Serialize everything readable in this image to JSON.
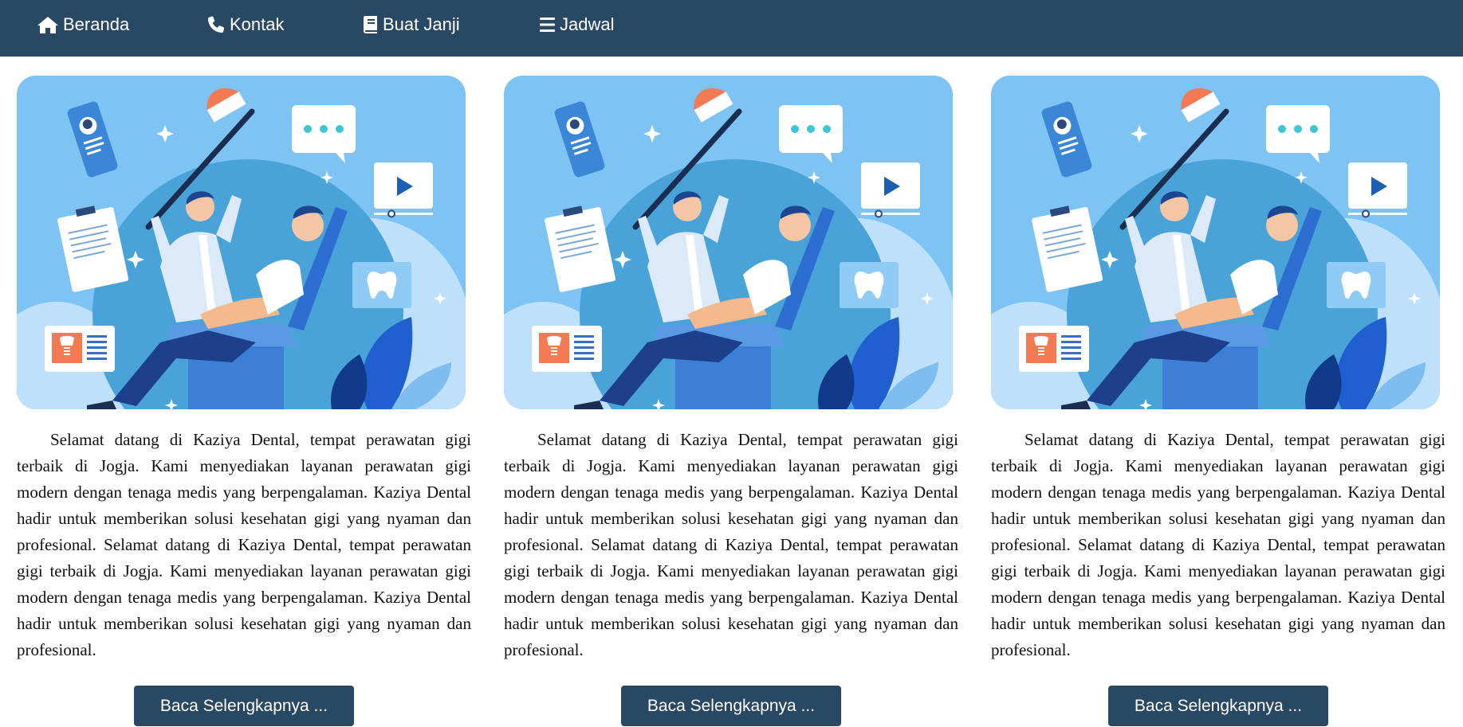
{
  "nav": {
    "items": [
      {
        "label": "Beranda",
        "icon": "home-icon"
      },
      {
        "label": "Kontak",
        "icon": "phone-icon"
      },
      {
        "label": "Buat Janji",
        "icon": "book-icon"
      },
      {
        "label": "Jadwal",
        "icon": "menu-icon"
      }
    ]
  },
  "colors": {
    "navbar": "#284863",
    "button": "#284863",
    "illustration_bg": "#7dc3f4"
  },
  "cards": [
    {
      "paragraph": "Selamat datang di Kaziya Dental, tempat perawatan gigi terbaik di Jogja. Kami menyediakan layanan perawatan gigi modern dengan tenaga medis yang berpengalaman. Kaziya Dental hadir untuk memberikan solusi kesehatan gigi yang nyaman dan profesional. Selamat datang di Kaziya Dental, tempat perawatan gigi terbaik di Jogja. Kami menyediakan layanan perawatan gigi modern dengan tenaga medis yang berpengalaman. Kaziya Dental hadir untuk memberikan solusi kesehatan gigi yang nyaman dan profesional.",
      "button_label": "Baca Selengkapnya ..."
    },
    {
      "paragraph": "Selamat datang di Kaziya Dental, tempat perawatan gigi terbaik di Jogja. Kami menyediakan layanan perawatan gigi modern dengan tenaga medis yang berpengalaman. Kaziya Dental hadir untuk memberikan solusi kesehatan gigi yang nyaman dan profesional. Selamat datang di Kaziya Dental, tempat perawatan gigi terbaik di Jogja. Kami menyediakan layanan perawatan gigi modern dengan tenaga medis yang berpengalaman. Kaziya Dental hadir untuk memberikan solusi kesehatan gigi yang nyaman dan profesional.",
      "button_label": "Baca Selengkapnya ..."
    },
    {
      "paragraph": "Selamat datang di Kaziya Dental, tempat perawatan gigi terbaik di Jogja. Kami menyediakan layanan perawatan gigi modern dengan tenaga medis yang berpengalaman. Kaziya Dental hadir untuk memberikan solusi kesehatan gigi yang nyaman dan profesional. Selamat datang di Kaziya Dental, tempat perawatan gigi terbaik di Jogja. Kami menyediakan layanan perawatan gigi modern dengan tenaga medis yang berpengalaman. Kaziya Dental hadir untuk memberikan solusi kesehatan gigi yang nyaman dan profesional.",
      "button_label": "Baca Selengkapnya ..."
    }
  ]
}
